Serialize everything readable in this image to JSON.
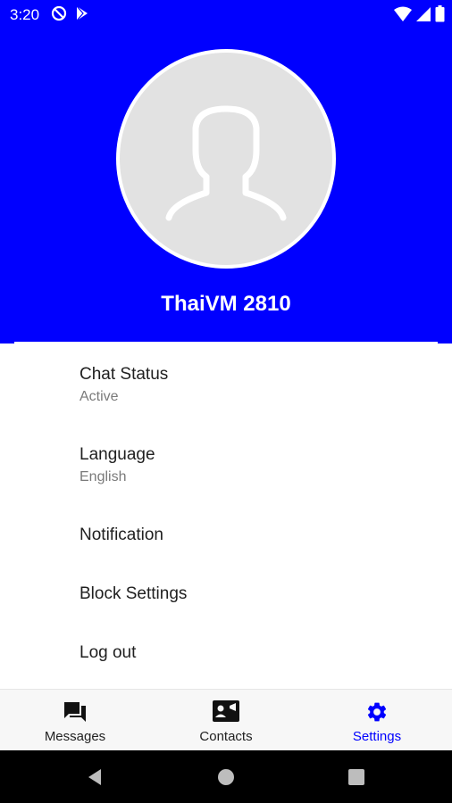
{
  "colors": {
    "accent": "#0000ff",
    "header_bg": "#0000ff",
    "nav_bg": "#f7f7f7",
    "system_nav_bg": "#000000"
  },
  "status_bar": {
    "time": "3:20",
    "left_icons": [
      "do-not-disturb-icon",
      "play-store-icon"
    ],
    "right_icons": [
      "wifi-icon",
      "cell-signal-icon",
      "battery-icon"
    ]
  },
  "profile": {
    "avatar_icon": "person-silhouette-icon",
    "name": "ThaiVM 2810"
  },
  "settings": {
    "items": [
      {
        "title": "Chat Status",
        "subtitle": "Active"
      },
      {
        "title": "Language",
        "subtitle": "English"
      },
      {
        "title": "Notification"
      },
      {
        "title": "Block Settings"
      },
      {
        "title": "Log out"
      }
    ]
  },
  "bottom_nav": {
    "active": "Settings",
    "items": [
      {
        "label": "Messages",
        "icon": "chat-bubbles-icon"
      },
      {
        "label": "Contacts",
        "icon": "contact-card-icon"
      },
      {
        "label": "Settings",
        "icon": "gear-icon"
      }
    ]
  },
  "system_nav": {
    "buttons": [
      "back-icon",
      "home-icon",
      "recents-icon"
    ]
  }
}
